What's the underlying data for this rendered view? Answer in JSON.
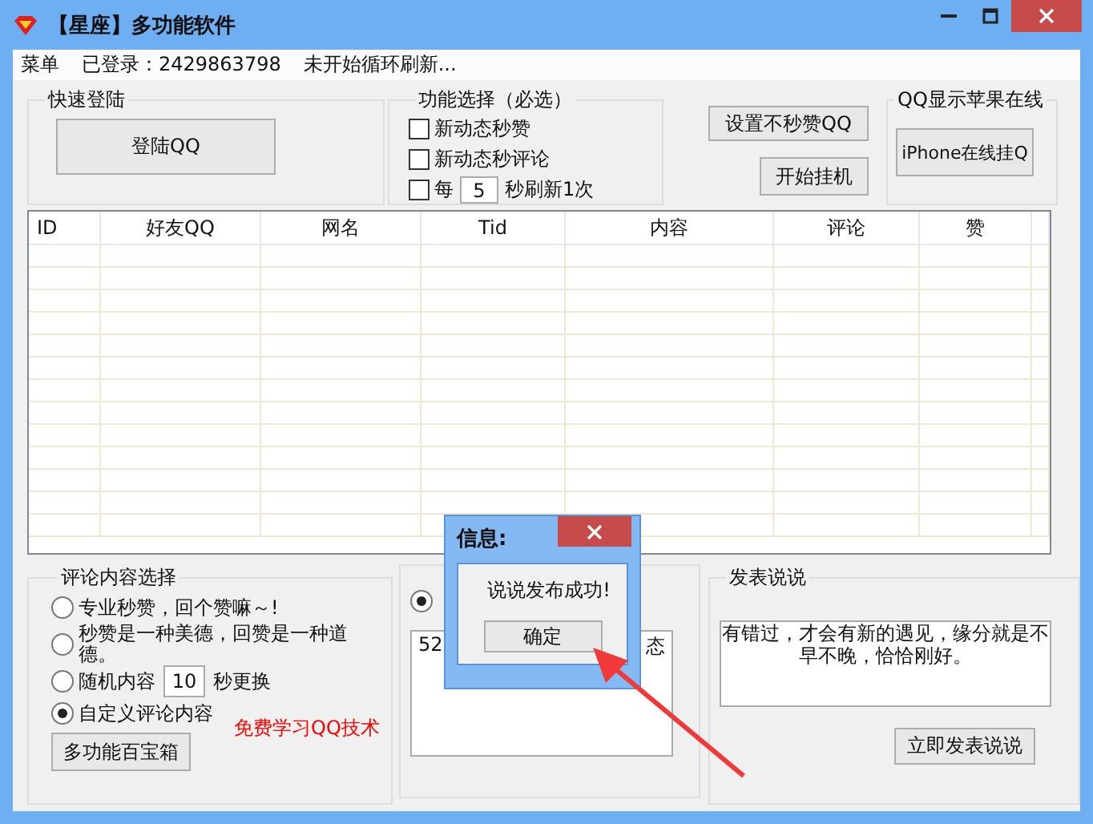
{
  "window": {
    "title": "【星座】多功能软件"
  },
  "menu": [
    "菜单"
  ],
  "login_status": "已登录：2429863798",
  "refresh_status": "未开始循环刷新...",
  "quick_login": {
    "title": "快速登陆",
    "button": "登陆QQ"
  },
  "functions": {
    "title": "功能选择（必选）",
    "options": [
      {
        "kind": "checkbox",
        "label": "新动态秒赞",
        "checked": false
      },
      {
        "kind": "checkbox",
        "label": "新动态秒评论",
        "checked": false
      },
      {
        "kind": "interval",
        "label_before": "每",
        "value": "5",
        "label_after": "秒刷新1次",
        "checked": false
      }
    ]
  },
  "actions": [
    "设置不秒赞QQ",
    "开始挂机"
  ],
  "iphone": {
    "title": "QQ显示苹果在线",
    "button": "iPhone在线挂Q"
  },
  "table": {
    "columns": [
      "ID",
      "好友QQ",
      "网名",
      "Tid",
      "内容",
      "评论",
      "赞"
    ]
  },
  "comment": {
    "title": "评论内容选择",
    "options": [
      {
        "kind": "text",
        "label": "专业秒赞，回个赞嘛～!",
        "selected": false
      },
      {
        "kind": "text",
        "label": "秒赞是一种美德，回赞是一种道德。",
        "selected": false
      },
      {
        "kind": "interval",
        "label_before": "随机内容",
        "value": "10",
        "label_after": "秒更换",
        "selected": false
      },
      {
        "kind": "text",
        "label": "自定义评论内容",
        "selected": true
      }
    ],
    "promo": "免费学习QQ技术",
    "button": "多功能百宝箱"
  },
  "middle": {
    "radio": {
      "selected": true
    },
    "text_parts": [
      "52",
      "态"
    ]
  },
  "post": {
    "title": "发表说说",
    "text": "有错过，才会有新的遇见，缘分就是不早不晚，恰恰刚好。",
    "button": "立即发表说说"
  },
  "dialog": {
    "title": "信息:",
    "message": "说说发布成功!",
    "button": "确定"
  }
}
